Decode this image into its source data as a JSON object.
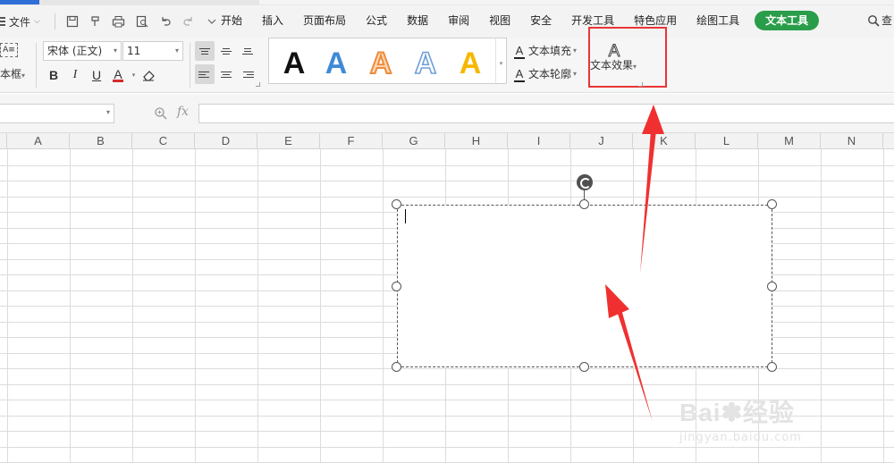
{
  "menubar": {
    "file_label": "文件",
    "tabs": [
      "开始",
      "插入",
      "页面布局",
      "公式",
      "数据",
      "审阅",
      "视图",
      "安全",
      "开发工具",
      "特色应用",
      "绘图工具"
    ],
    "active_tab": "文本工具",
    "search_label": "查"
  },
  "ribbon": {
    "textbox_label": "本框",
    "textbox_icon_text": "A≡",
    "font_name": "宋体 (正文)",
    "font_size": "11",
    "format_buttons": {
      "bold": "B",
      "italic": "I",
      "underline": "U",
      "font_color": "A"
    },
    "font_color_bar": "#d32b2b",
    "gallery": [
      {
        "style": "black-solid",
        "color": "#111111"
      },
      {
        "style": "blue-solid",
        "color": "#3f8ad6"
      },
      {
        "style": "orange-outline",
        "color": "#ee8b3a"
      },
      {
        "style": "blue-outline",
        "color": "#6f9fd8"
      },
      {
        "style": "gold-solid",
        "color": "#f5b800"
      }
    ],
    "text_fill_label": "文本填充",
    "text_outline_label": "文本轮廓",
    "text_effect_label": "文本效果",
    "highlight_color": "#ea3535"
  },
  "formula": {
    "fx_label": "fx"
  },
  "sheet": {
    "columns": [
      "A",
      "B",
      "C",
      "D",
      "E",
      "F",
      "G",
      "H",
      "I",
      "J",
      "K",
      "L",
      "M",
      "N"
    ]
  },
  "annotation": {
    "arrow_color": "#f03030",
    "count": 2
  },
  "watermark": {
    "brand": "Bai",
    "brand_suffix": "经验",
    "site": "jingyan.baidu.com"
  },
  "accent_color": "#2a9d4a"
}
